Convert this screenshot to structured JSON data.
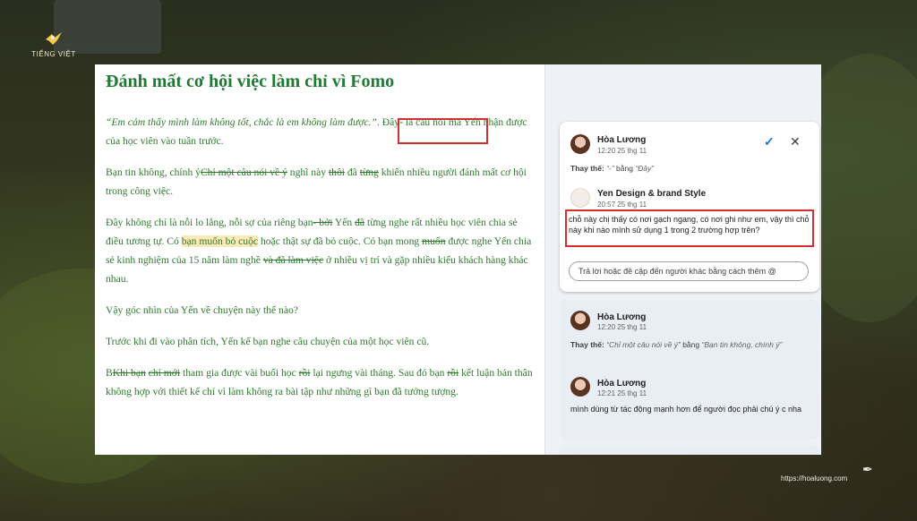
{
  "brand": {
    "logo_text": "TIẾNG VIỆT"
  },
  "document": {
    "title": "Đánh mất cơ hội việc làm chỉ vì Fomo",
    "p1_quote": "“Em cảm thấy mình làm không tốt, chắc là em không làm được.”",
    "p1_mark": ". ",
    "p1_inserted": "Đây",
    "p1_cursor": "-",
    "p1_rest": " là câu nói mà Yến nhận được của học viên vào tuần trước.",
    "p2_a": "Bạn tin không, chính ý",
    "p2_del1": "Chỉ một câu nói về ý",
    "p2_b": " nghĩ này ",
    "p2_del2": "thôi",
    "p2_c": " đã ",
    "p2_del3": "từng",
    "p2_d": " khiến nhiều người đánh mất cơ hội trong công việc.",
    "p3_a": "Đây không chỉ là nỗi lo lắng, nỗi sợ của riêng bạn",
    "p3_del1": "- bởi",
    "p3_b": " Yến ",
    "p3_del2": "đã",
    "p3_c": " từng nghe rất nhiều học viên chia sẻ điều tương tự. Có ",
    "p3_hl": "bạn muốn bỏ cuộc",
    "p3_d": " hoặc thật sự đã bỏ cuộc. Có bạn mong ",
    "p3_del3": "muốn",
    "p3_e": " được nghe Yến chia sẻ kinh nghiệm của 15 năm làm nghề ",
    "p3_del4": "và đã làm việc",
    "p3_f": " ở nhiều vị trí và gặp nhiều kiểu khách hàng khác nhau.",
    "p4": "Vậy góc nhìn của Yến về chuyện này thế nào?",
    "p5": "Trước khi đi vào phân tích, Yến kể bạn nghe câu chuyện của một học viên cũ.",
    "p6_a": "B",
    "p6_del1": "Khi bạn",
    "p6_b": " ",
    "p6_del2": "chỉ mới",
    "p6_c": " tham gia được vài buổi học ",
    "p6_del3": "rồi",
    "p6_d": " lại ngưng vài tháng. Sau đó bạn ",
    "p6_del4": "rồi",
    "p6_e": " kết luận bản thân không hợp với thiết kế chỉ vì làm không ra bài tập như những gì bạn đã tưởng tượng."
  },
  "comments": {
    "card1": {
      "author": "Hòa Lương",
      "time": "12:20 25 thg 11",
      "replace_label": "Thay thế:",
      "replace_from": "“-”",
      "replace_by": "bằng",
      "replace_to": "“Đây”",
      "reply_author": "Yen Design & brand Style",
      "reply_time": "20:57 25 thg 11",
      "reply_body": "chỗ này chị thấy có nơi gạch ngang, có nơi ghi như em, vậy thì chỗ này khi nào mình sử dụng 1 trong 2 trường hợp trên?",
      "reply_placeholder": "Trả lời hoặc đề cập đến người khác bằng cách thêm @"
    },
    "card2": {
      "author": "Hòa Lương",
      "time": "12:20 25 thg 11",
      "replace_label": "Thay thế:",
      "replace_from": "“Chỉ một câu nói về ý”",
      "replace_by": "bằng",
      "replace_to": "“Bạn tin không, chính ý”",
      "reply_author": "Hòa Lương",
      "reply_time": "12:21 25 thg 11",
      "reply_body": "mình dùng từ tác động mạnh hơn để người đọc phải chú ý c nha"
    }
  },
  "footer": {
    "url": "https://hoaluong.com"
  }
}
